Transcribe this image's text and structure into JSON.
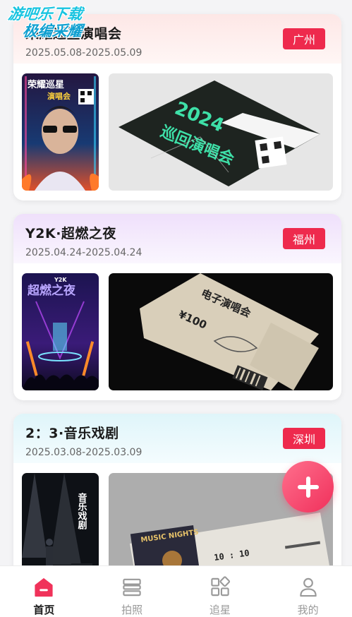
{
  "watermark": {
    "line1": "游吧乐下载",
    "line2": "极编采耀"
  },
  "cards": [
    {
      "title": "荣耀巡星演唱会",
      "date_range": "2025.05.08-2025.05.09",
      "city": "广州",
      "header_color": "#fdeceb"
    },
    {
      "title": "Y2K·超燃之夜",
      "date_range": "2025.04.24-2025.04.24",
      "city": "福州",
      "header_color": "#f2e7fb"
    },
    {
      "title": "2：3·音乐戏剧",
      "date_range": "2025.03.08-2025.03.09",
      "city": "深圳",
      "header_color": "#e4f7fb"
    }
  ],
  "poster_texts": {
    "card1": {
      "poster_title": "荣耀巡星",
      "poster_sub": "演唱会",
      "ticket_year": "2024",
      "ticket_title": "巡回演唱会"
    },
    "card2": {
      "poster_tag": "Y2K",
      "poster_title": "超燃之夜",
      "ticket_title": "电子演唱会",
      "ticket_price": "¥100"
    },
    "card3": {
      "poster_title": "音乐戏剧",
      "ticket_brand": "MUSIC NIGHTS",
      "ticket_time": "10 : 10"
    }
  },
  "fab": {
    "icon": "plus-icon"
  },
  "tabbar": {
    "items": [
      {
        "label": "首页",
        "icon": "home-icon",
        "active": true
      },
      {
        "label": "拍照",
        "icon": "camera-icon",
        "active": false
      },
      {
        "label": "追星",
        "icon": "grid-icon",
        "active": false
      },
      {
        "label": "我的",
        "icon": "user-icon",
        "active": false
      }
    ]
  },
  "colors": {
    "accent": "#ee2a4d",
    "fab_start": "#ff6f8d",
    "fab_end": "#f0305b"
  }
}
